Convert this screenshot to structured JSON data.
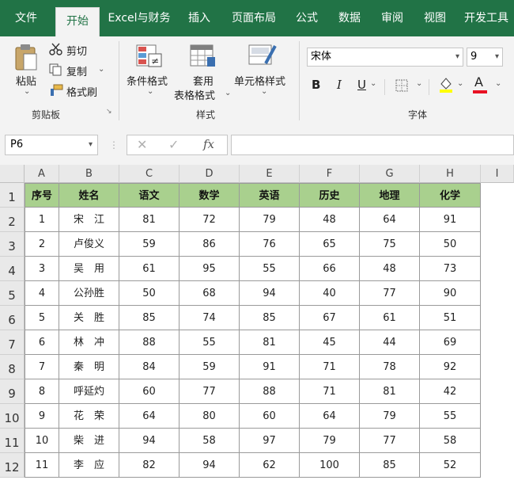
{
  "menu": {
    "tabs": [
      "文件",
      "开始",
      "Excel与财务",
      "插入",
      "页面布局",
      "公式",
      "数据",
      "审阅",
      "视图",
      "开发工具"
    ]
  },
  "ribbon": {
    "paste": "粘贴",
    "cut": "剪切",
    "copy": "复制",
    "format_painter": "格式刷",
    "clipboard_group": "剪贴板",
    "conditional_format": "条件格式",
    "table_format_1": "套用",
    "table_format_2": "表格格式",
    "cell_style": "单元格样式",
    "styles_group": "样式",
    "font_name": "宋体",
    "font_size": "9",
    "bold": "B",
    "italic": "I",
    "underline": "U",
    "font_color_letter": "A",
    "font_group": "字体"
  },
  "formula_bar": {
    "name_box": "P6",
    "fx": "fx",
    "content": ""
  },
  "columns": [
    "A",
    "B",
    "C",
    "D",
    "E",
    "F",
    "G",
    "H",
    "I"
  ],
  "rows": [
    "1",
    "2",
    "3",
    "4",
    "5",
    "6",
    "7",
    "8",
    "9",
    "10",
    "11",
    "12"
  ],
  "table": {
    "headers": [
      "序号",
      "姓名",
      "语文",
      "数学",
      "英语",
      "历史",
      "地理",
      "化学"
    ],
    "rows": [
      [
        "1",
        "宋　江",
        "81",
        "72",
        "79",
        "48",
        "64",
        "91"
      ],
      [
        "2",
        "卢俊义",
        "59",
        "86",
        "76",
        "65",
        "75",
        "50"
      ],
      [
        "3",
        "吴　用",
        "61",
        "95",
        "55",
        "66",
        "48",
        "73"
      ],
      [
        "4",
        "公孙胜",
        "50",
        "68",
        "94",
        "40",
        "77",
        "90"
      ],
      [
        "5",
        "关　胜",
        "85",
        "74",
        "85",
        "67",
        "61",
        "51"
      ],
      [
        "6",
        "林　冲",
        "88",
        "55",
        "81",
        "45",
        "44",
        "69"
      ],
      [
        "7",
        "秦　明",
        "84",
        "59",
        "91",
        "71",
        "78",
        "92"
      ],
      [
        "8",
        "呼延灼",
        "60",
        "77",
        "88",
        "71",
        "81",
        "42"
      ],
      [
        "9",
        "花　荣",
        "64",
        "80",
        "60",
        "64",
        "79",
        "55"
      ],
      [
        "10",
        "柴　进",
        "94",
        "58",
        "97",
        "79",
        "77",
        "58"
      ],
      [
        "11",
        "李　应",
        "82",
        "94",
        "62",
        "100",
        "85",
        "52"
      ]
    ]
  },
  "colors": {
    "excel_green": "#217346",
    "header_fill": "#a9d08e"
  }
}
